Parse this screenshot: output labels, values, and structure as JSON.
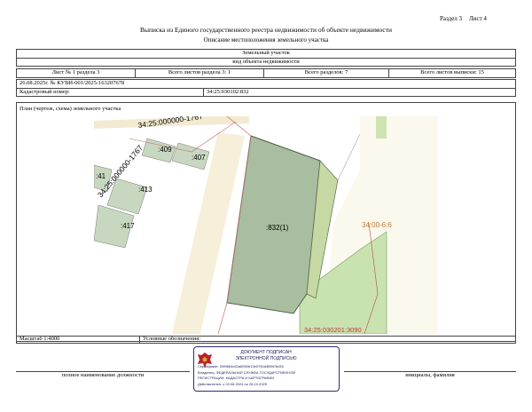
{
  "header": {
    "section_label": "Раздел 3",
    "sheet_label": "Лист 4",
    "title": "Выписка из Единого государственного реестра недвижимости об объекте недвижимости",
    "subtitle": "Описание местоположения земельного участка"
  },
  "object": {
    "type": "Земельный участок",
    "kind_caption": "вид объекта недвижимости"
  },
  "info_row": {
    "sheet_of_section": "Лист № 1 раздела 3",
    "total_sheets_section": "Всего листов раздела 3: 1",
    "total_sections": "Всего разделов: 7",
    "total_sheets_extract": "Всего листов выписки: 15"
  },
  "doc_row": {
    "date_number": "26.08.2025г. № КУВИ-001/2025-163207678"
  },
  "cadastral": {
    "label": "Кадастровый номер:",
    "value": "34:25:030102:832"
  },
  "plan": {
    "title": "План (чертеж, схема) земельного участка",
    "labels": {
      "block_top": "34:25:000000-1767",
      "block_diag": "34:25:000000-1767",
      "parcel_409": ":409",
      "parcel_407": ":407",
      "parcel_41": ":41",
      "parcel_413": ":413",
      "parcel_417": ":417",
      "parcel_main": ":832(1)",
      "quarter_right": "34:00-6:6",
      "quarter_bottom": "34:25:030201:3090"
    }
  },
  "footer": {
    "scale": "Масштаб 1:4000",
    "legend": "Условные обозначения:",
    "position_caption": "полное наименование должности",
    "name_caption": "инициалы, фамилия"
  },
  "stamp": {
    "line1": "ДОКУМЕНТ ПОДПИСАН",
    "line2": "ЭЛЕКТРОННОЙ ПОДПИСЬЮ",
    "line3": "Сертификат: 00f98b4c63a6050b13e0750d4f55f76c55",
    "line4": "Владелец: ФЕДЕРАЛЬНАЯ СЛУЖБА ГОСУДАРСТВЕННОЙ",
    "line5": "РЕГИСТРАЦИИ, КАДАСТРА И КАРТОГРАФИИ",
    "line6": "Действителен: с 02.06.2024 по 26.10.2025"
  }
}
